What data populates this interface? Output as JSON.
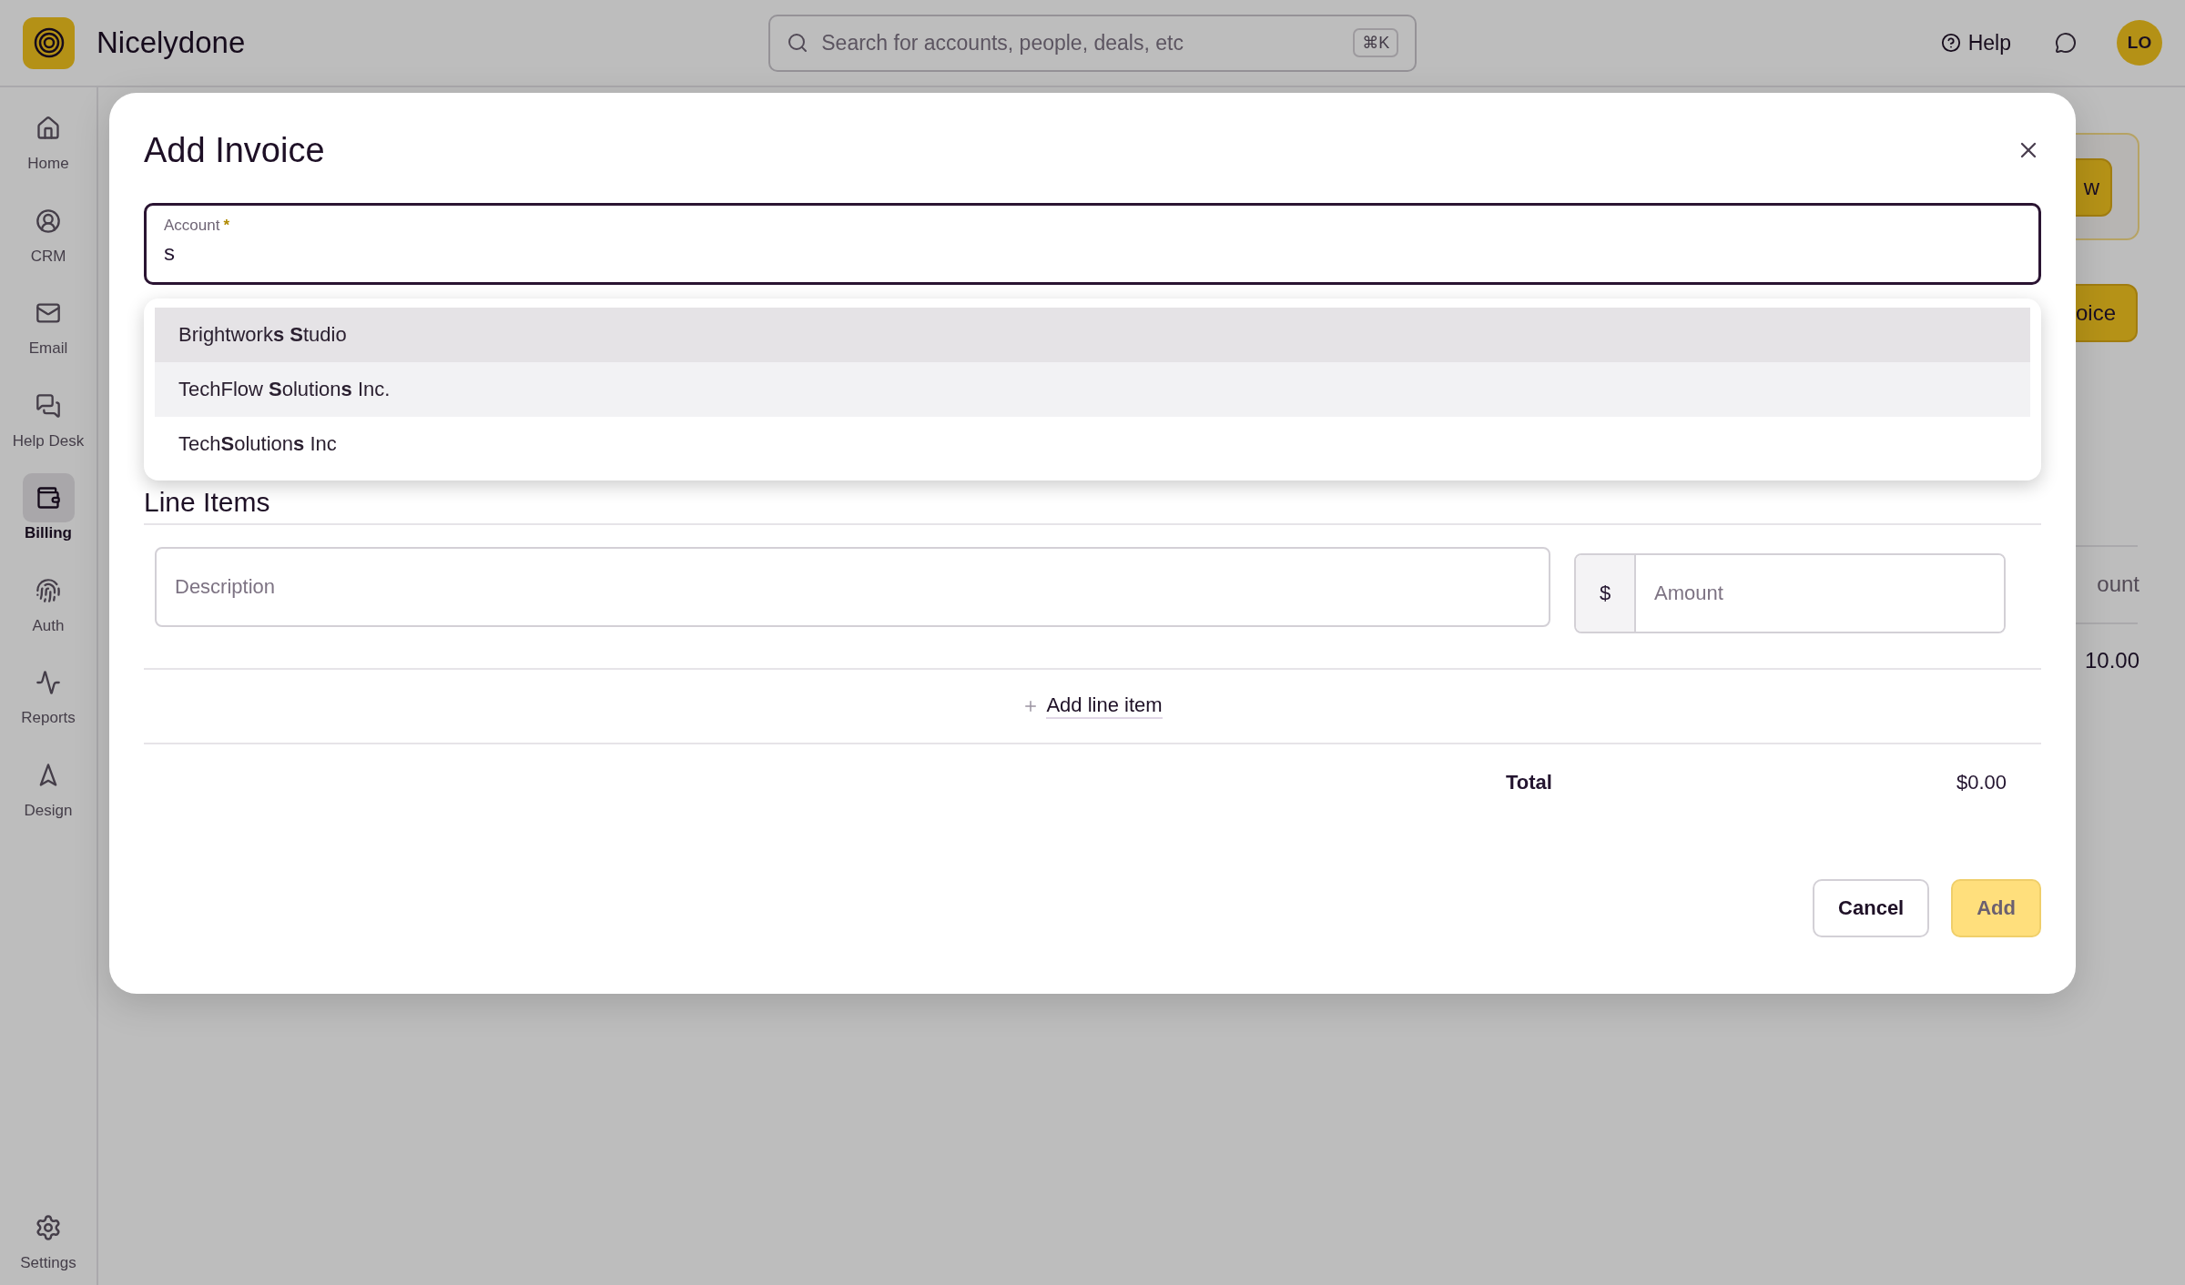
{
  "app": {
    "name": "Nicelydone"
  },
  "search": {
    "placeholder": "Search for accounts, people, deals, etc",
    "shortcut": "⌘K"
  },
  "header_actions": {
    "help": "Help",
    "avatar": "LO"
  },
  "sidebar": {
    "items": [
      {
        "label": "Home",
        "selected": false
      },
      {
        "label": "CRM",
        "selected": false
      },
      {
        "label": "Email",
        "selected": false
      },
      {
        "label": "Help Desk",
        "selected": false
      },
      {
        "label": "Billing",
        "selected": true
      },
      {
        "label": "Auth",
        "selected": false
      },
      {
        "label": "Reports",
        "selected": false
      },
      {
        "label": "Design",
        "selected": false
      }
    ],
    "footer": {
      "label": "Settings"
    }
  },
  "background": {
    "buttons": [
      "w",
      "oice"
    ],
    "column_fragment": "ount",
    "cell_fragment": "10.00"
  },
  "dialog": {
    "title": "Add Invoice",
    "account": {
      "label": "Account",
      "required_mark": "*",
      "value": "s"
    },
    "suggestions": [
      {
        "label": "Brightwork**s** **S**tudio",
        "selected": true,
        "hovered": false
      },
      {
        "label": "TechFlow **S**olution**s** Inc.",
        "selected": false,
        "hovered": true
      },
      {
        "label": "Tech**S**olution**s** Inc",
        "selected": false,
        "hovered": false
      }
    ],
    "section": "Line Items",
    "line_item": {
      "description_placeholder": "Description",
      "currency": "$",
      "amount_placeholder": "Amount"
    },
    "add_line": "Add line item",
    "total": {
      "label": "Total",
      "value": "$0.00"
    },
    "buttons": {
      "cancel": "Cancel",
      "submit": "Add"
    }
  }
}
